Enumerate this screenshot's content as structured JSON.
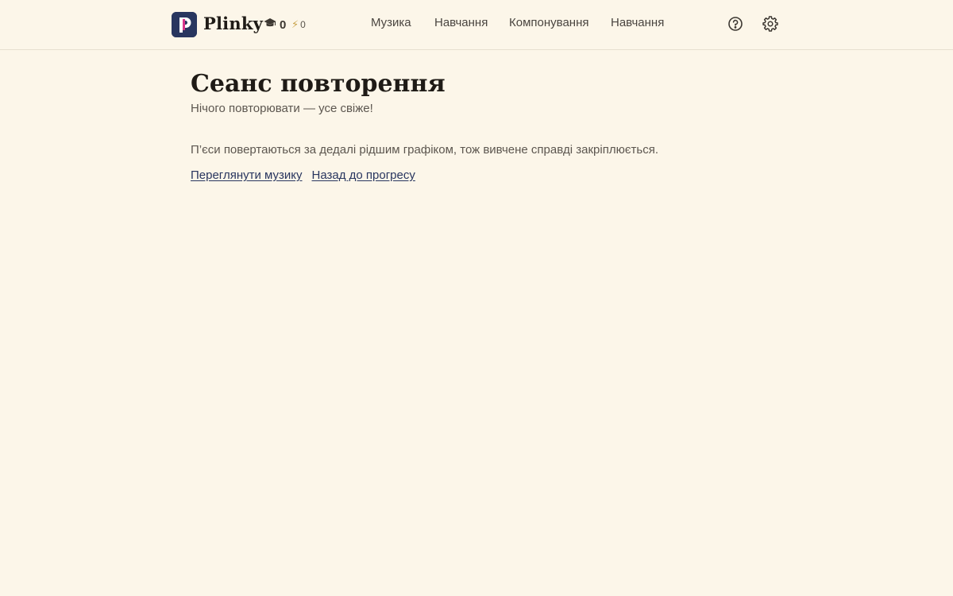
{
  "header": {
    "brand": "Plinky",
    "stats": {
      "scholar_count": "0",
      "streak_count": "0"
    },
    "nav": [
      {
        "label": "Музика"
      },
      {
        "label": "Навчання"
      },
      {
        "label": "Компонування"
      },
      {
        "label": "Навчання"
      }
    ],
    "icons": {
      "help": "help-circle-icon",
      "settings": "gear-icon"
    }
  },
  "main": {
    "title": "Сеанс повторення",
    "subtitle": "Нічого повторювати — усе свіже!",
    "description": "П’єси повертаються за дедалі рідшим графіком, тож вивчене справді закріплюється.",
    "links": {
      "browse_music": "Переглянути музику",
      "back_to_progress": "Назад до прогресу"
    }
  },
  "colors": {
    "background": "#fcf6e9",
    "brand_navy": "#28365f",
    "brand_pink": "#d8348a",
    "accent_gold": "#c8a34a"
  }
}
